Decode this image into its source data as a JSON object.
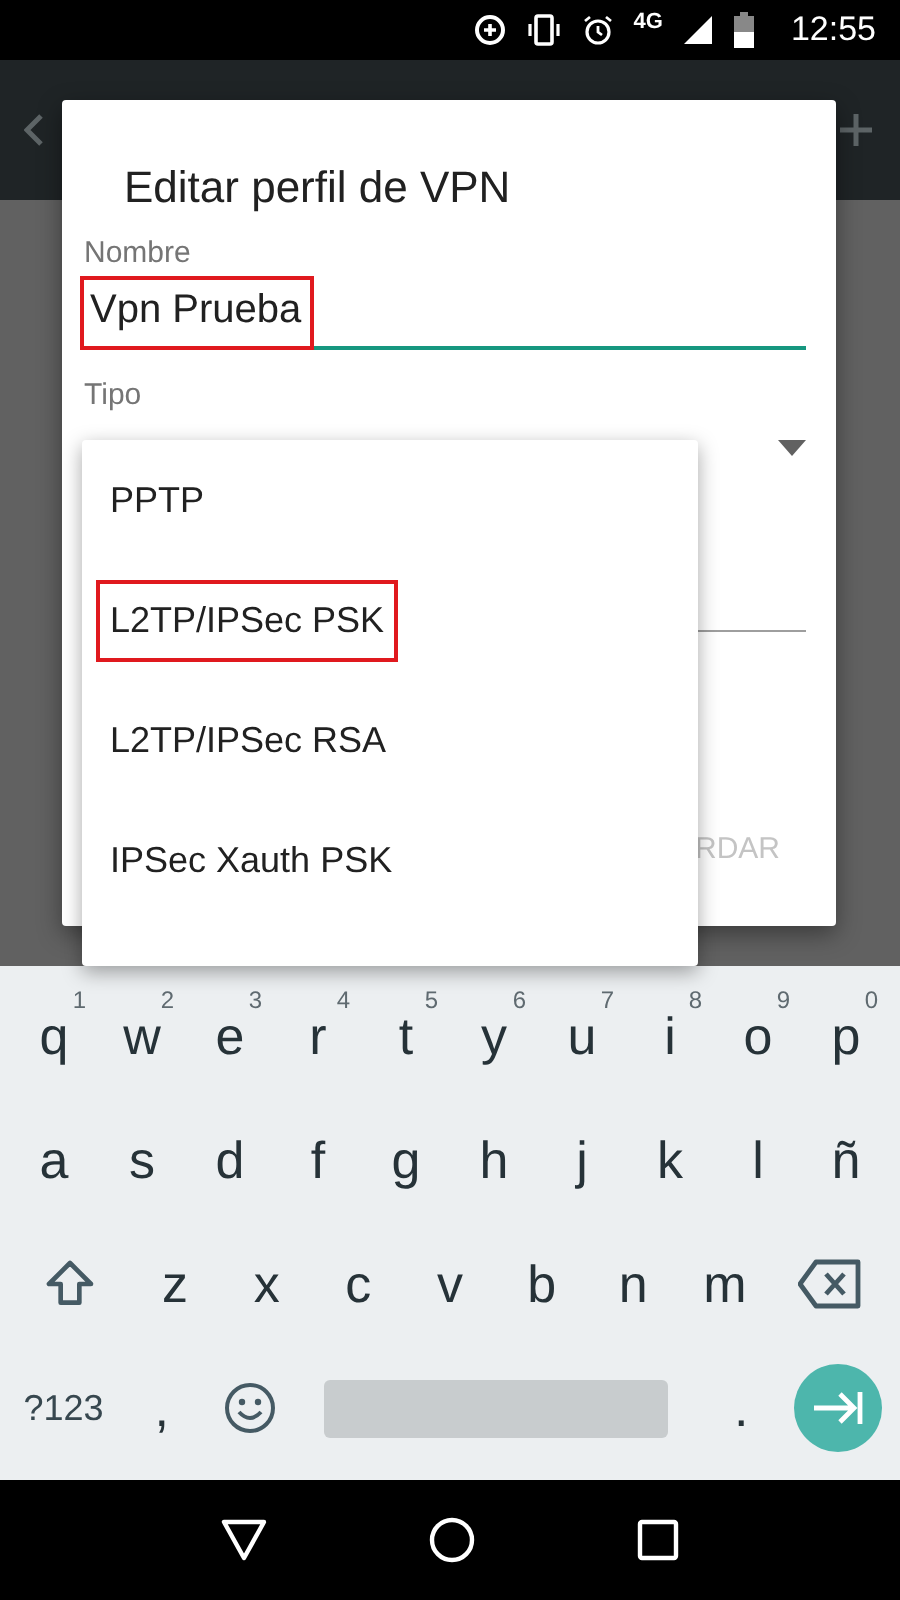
{
  "status_bar": {
    "network": "4G",
    "time": "12:55"
  },
  "dialog": {
    "title": "Editar perfil de VPN",
    "fields": [
      {
        "label": "Nombre",
        "value": "Vpn Prueba",
        "highlighted": true,
        "focused": true
      },
      {
        "label": "Tipo"
      }
    ],
    "action": "RDAR"
  },
  "dropdown": {
    "options": [
      {
        "label": "PPTP",
        "highlighted": false
      },
      {
        "label": "L2TP/IPSec PSK",
        "highlighted": true
      },
      {
        "label": "L2TP/IPSec RSA",
        "highlighted": false
      },
      {
        "label": "IPSec Xauth PSK",
        "highlighted": false
      }
    ]
  },
  "keyboard": {
    "rows": [
      [
        {
          "kind": "char",
          "label": "q",
          "hint": "1"
        },
        {
          "kind": "char",
          "label": "w",
          "hint": "2"
        },
        {
          "kind": "char",
          "label": "e",
          "hint": "3"
        },
        {
          "kind": "char",
          "label": "r",
          "hint": "4"
        },
        {
          "kind": "char",
          "label": "t",
          "hint": "5"
        },
        {
          "kind": "char",
          "label": "y",
          "hint": "6"
        },
        {
          "kind": "char",
          "label": "u",
          "hint": "7"
        },
        {
          "kind": "char",
          "label": "i",
          "hint": "8"
        },
        {
          "kind": "char",
          "label": "o",
          "hint": "9"
        },
        {
          "kind": "char",
          "label": "p",
          "hint": "0"
        }
      ],
      [
        {
          "kind": "char",
          "label": "a"
        },
        {
          "kind": "char",
          "label": "s"
        },
        {
          "kind": "char",
          "label": "d"
        },
        {
          "kind": "char",
          "label": "f"
        },
        {
          "kind": "char",
          "label": "g"
        },
        {
          "kind": "char",
          "label": "h"
        },
        {
          "kind": "char",
          "label": "j"
        },
        {
          "kind": "char",
          "label": "k"
        },
        {
          "kind": "char",
          "label": "l"
        },
        {
          "kind": "char",
          "label": "ñ"
        }
      ],
      [
        {
          "kind": "shift"
        },
        {
          "kind": "char",
          "label": "z"
        },
        {
          "kind": "char",
          "label": "x"
        },
        {
          "kind": "char",
          "label": "c"
        },
        {
          "kind": "char",
          "label": "v"
        },
        {
          "kind": "char",
          "label": "b"
        },
        {
          "kind": "char",
          "label": "n"
        },
        {
          "kind": "char",
          "label": "m"
        },
        {
          "kind": "backspace"
        }
      ],
      [
        {
          "kind": "symbols",
          "label": "?123"
        },
        {
          "kind": "char",
          "label": ","
        },
        {
          "kind": "emoji"
        },
        {
          "kind": "space"
        },
        {
          "kind": "char",
          "label": "."
        },
        {
          "kind": "enter"
        }
      ]
    ]
  }
}
